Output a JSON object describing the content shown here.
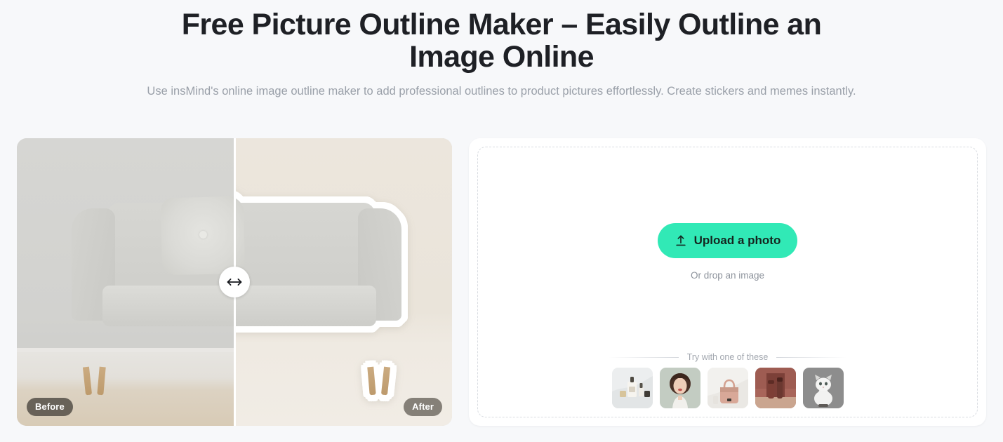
{
  "header": {
    "title": "Free Picture Outline Maker – Easily Outline an Image Online",
    "subtitle": "Use insMind's online image outline maker to add professional outlines to product pictures effortlessly. Create stickers and memes instantly."
  },
  "comparison": {
    "before_label": "Before",
    "after_label": "After",
    "handle_icon": "horizontal-resize-arrows-icon",
    "divider_position_percent": 50,
    "before_image_alt": "Light grey sofa with cushion against a grey wall",
    "after_image_alt": "Same sofa cut out with a thick white outline on a beige background"
  },
  "upload": {
    "button_label": "Upload a photo",
    "button_icon": "upload-arrow-icon",
    "button_color": "#31e9b6",
    "drop_hint": "Or drop an image",
    "samples_label": "Try with one of these",
    "samples": [
      {
        "name": "skincare-bottles",
        "alt": "Skincare serum bottles on a white surface"
      },
      {
        "name": "woman-portrait",
        "alt": "Smiling woman with curly dark hair"
      },
      {
        "name": "pink-handbag",
        "alt": "Pink leather handbag"
      },
      {
        "name": "cosmetic-tubes",
        "alt": "Two cosmetic tubes on a maroon backdrop"
      },
      {
        "name": "white-cat",
        "alt": "White and grey cat sitting"
      }
    ]
  },
  "theme": {
    "page_background": "#f7f8fa",
    "title_color": "#1e2025",
    "subtitle_color": "#9aa0a9",
    "accent": "#31e9b6"
  }
}
